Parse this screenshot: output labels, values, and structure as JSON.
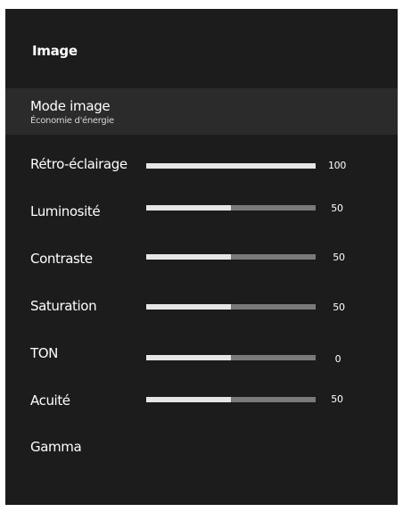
{
  "panel": {
    "title": "Image",
    "mode": {
      "label": "Mode image",
      "value": "Économie d'énergie"
    },
    "settings": [
      {
        "label": "Rétro-éclairage",
        "value": "100",
        "level": 1.0
      },
      {
        "label": "Luminosité",
        "value": "50",
        "level": 0.5
      },
      {
        "label": "Contraste",
        "value": "50",
        "level": 0.5
      },
      {
        "label": "Saturation",
        "value": "50",
        "level": 0.5
      },
      {
        "label": "TON",
        "value": "0",
        "level": 0.5
      },
      {
        "label": "Acuité",
        "value": "50",
        "level": 0.5
      }
    ],
    "gamma": {
      "label": "Gamma"
    }
  },
  "colors": {
    "background": "#1c1c1c",
    "highlight": "#2b2b2b",
    "slider_fill": "#e6e6e6",
    "slider_track": "#7a7a7a"
  }
}
